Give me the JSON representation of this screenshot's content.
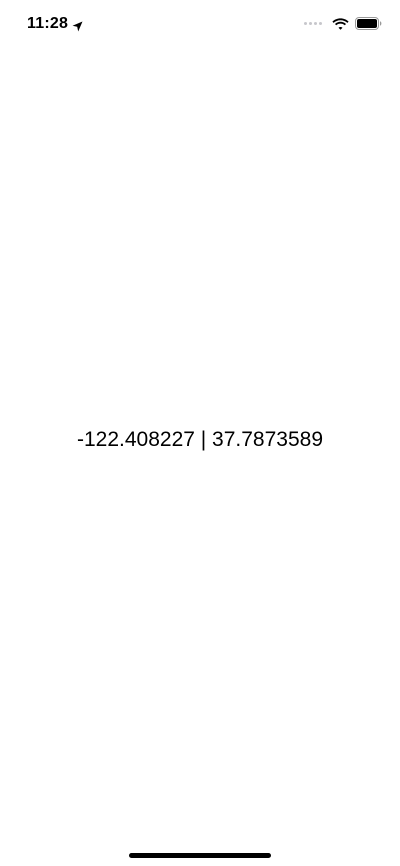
{
  "status_bar": {
    "time": "11:28",
    "icons": [
      "location-arrow-icon",
      "cellular-dots-icon",
      "wifi-icon",
      "battery-icon"
    ]
  },
  "main": {
    "coordinates_text": "-122.408227 | 37.7873589"
  }
}
